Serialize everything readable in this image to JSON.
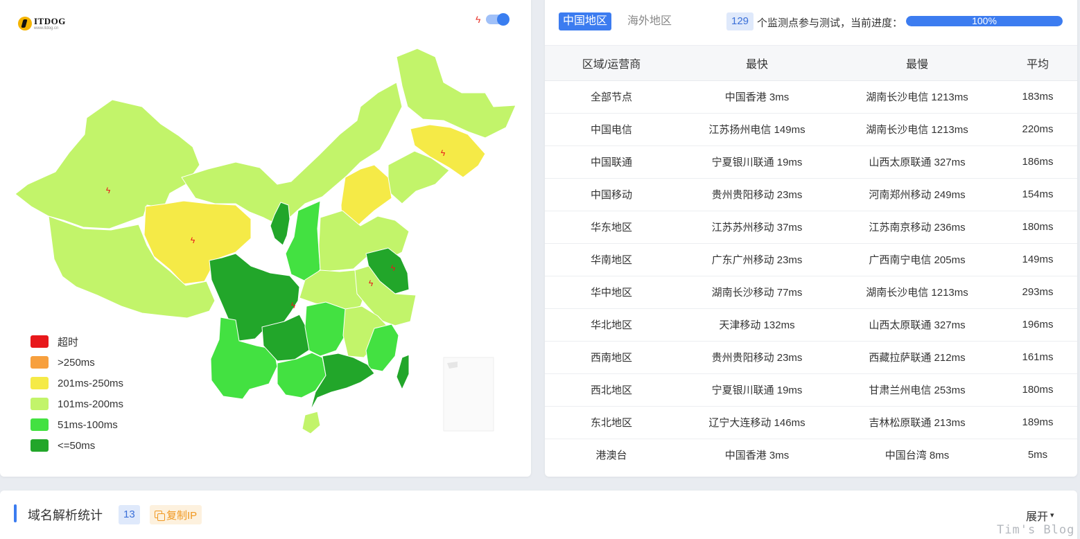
{
  "logo": {
    "name": "ITDOG",
    "sub": "www.itdog.cn"
  },
  "legend": [
    {
      "label": "超时",
      "color": "#e8181b"
    },
    {
      "label": ">250ms",
      "color": "#f7a03e"
    },
    {
      "label": "201ms-250ms",
      "color": "#f5ea47"
    },
    {
      "label": "101ms-200ms",
      "color": "#c2f46a"
    },
    {
      "label": "51ms-100ms",
      "color": "#43e141"
    },
    {
      "label": "<=50ms",
      "color": "#22a62a"
    }
  ],
  "tabs": {
    "active": "中国地区",
    "inactive": "海外地区"
  },
  "monitor": {
    "count": "129",
    "text": "个监测点参与测试，当前进度：",
    "progress_label": "100%",
    "progress_fraction": 1.0
  },
  "table": {
    "headers": [
      "区域/运营商",
      "最快",
      "最慢",
      "平均"
    ],
    "rows": [
      [
        "全部节点",
        "中国香港 3ms",
        "湖南长沙电信 1213ms",
        "183ms"
      ],
      [
        "中国电信",
        "江苏扬州电信 149ms",
        "湖南长沙电信 1213ms",
        "220ms"
      ],
      [
        "中国联通",
        "宁夏银川联通 19ms",
        "山西太原联通 327ms",
        "186ms"
      ],
      [
        "中国移动",
        "贵州贵阳移动 23ms",
        "河南郑州移动 249ms",
        "154ms"
      ],
      [
        "华东地区",
        "江苏苏州移动 37ms",
        "江苏南京移动 236ms",
        "180ms"
      ],
      [
        "华南地区",
        "广东广州移动 23ms",
        "广西南宁电信 205ms",
        "149ms"
      ],
      [
        "华中地区",
        "湖南长沙移动 77ms",
        "湖南长沙电信 1213ms",
        "293ms"
      ],
      [
        "华北地区",
        "天津移动 132ms",
        "山西太原联通 327ms",
        "196ms"
      ],
      [
        "西南地区",
        "贵州贵阳移动 23ms",
        "西藏拉萨联通 212ms",
        "161ms"
      ],
      [
        "西北地区",
        "宁夏银川联通 19ms",
        "甘肃兰州电信 253ms",
        "180ms"
      ],
      [
        "东北地区",
        "辽宁大连移动 146ms",
        "吉林松原联通 213ms",
        "189ms"
      ],
      [
        "港澳台",
        "中国香港 3ms",
        "中国台湾 8ms",
        "5ms"
      ]
    ]
  },
  "dns": {
    "title": "域名解析统计",
    "count": "13",
    "copy_label": "复制IP",
    "expand_label": "展开",
    "expand_icon": "double-chevron-down-icon"
  },
  "watermark": "Tim's Blog"
}
